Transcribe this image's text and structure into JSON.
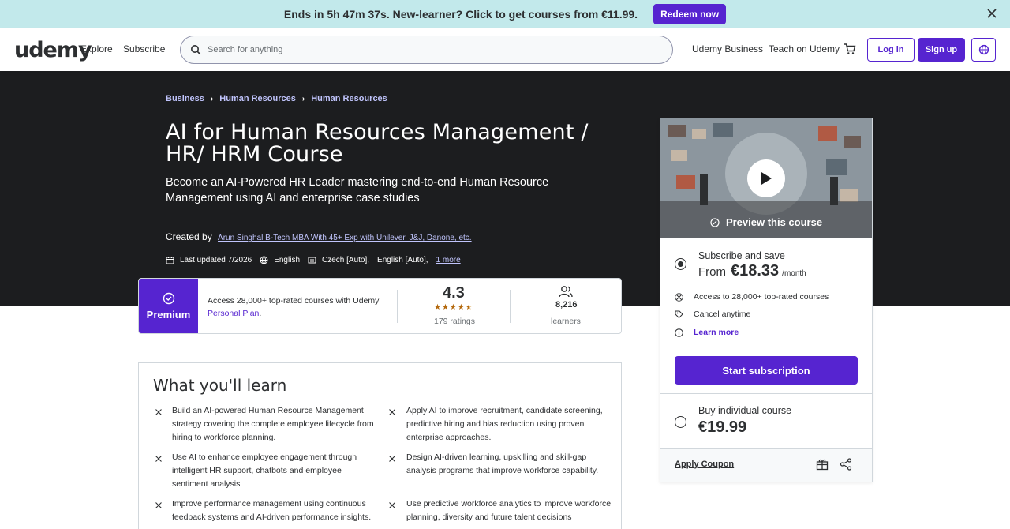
{
  "banner": {
    "text": "Ends in 5h 47m 37s. New-learner? Click to get courses from €11.99.",
    "button": "Redeem now",
    "bg_color": "#c2e9eb"
  },
  "header": {
    "logo": "udemy",
    "explore": "Explore",
    "subscribe": "Subscribe",
    "search_placeholder": "Search for anything",
    "business": "Udemy Business",
    "teach": "Teach on Udemy",
    "login": "Log in",
    "signup": "Sign up",
    "accent_color": "#5624d0"
  },
  "breadcrumb": [
    "Business",
    "Human Resources",
    "Human Resources"
  ],
  "course": {
    "title": "AI for Human Resources Management / HR/ HRM Course",
    "subtitle": "Become an AI-Powered HR Leader mastering end-to-end Human Resource Management using AI and enterprise case studies",
    "created_by_label": "Created by",
    "author": "Arun Singhal B-Tech MBA With 45+ Exp with Unilever, J&J, Danone, etc.",
    "last_updated": "Last updated 7/2026",
    "language": "English",
    "captions": [
      "Czech [Auto],",
      "English [Auto],"
    ],
    "more": "1 more"
  },
  "premium": {
    "label": "Premium",
    "text": "Access 28,000+ top-rated courses with Udemy",
    "link": "Personal Plan",
    "link_suffix": ".",
    "rating": "4.3",
    "stars": 4.5,
    "ratings_count": "179 ratings",
    "learners_count": "8,216",
    "learners_label": "learners"
  },
  "learn": {
    "title": "What you'll learn",
    "items": [
      "Build an AI-powered Human Resource Management strategy covering the complete employee lifecycle from hiring to workforce planning.",
      "Apply AI to improve recruitment, candidate screening, predictive hiring and bias reduction using proven enterprise approaches.",
      "Use AI to enhance employee engagement through intelligent HR support, chatbots and employee sentiment analysis",
      "Design AI-driven learning, upskilling and skill-gap analysis programs that improve workforce capability.",
      "Improve performance management using continuous feedback systems and AI-driven performance insights.",
      "Use predictive workforce analytics to improve workforce planning, diversity and future talent decisions"
    ]
  },
  "sidebar": {
    "preview": "Preview this course",
    "subscribe_label": "Subscribe and save",
    "from_label": "From",
    "sub_price": "€18.33",
    "per_month": "/month",
    "feature1": "Access to 28,000+ top-rated courses",
    "feature2": "Cancel anytime",
    "learn_more": "Learn more",
    "start_button": "Start subscription",
    "buy_label": "Buy individual course",
    "buy_price": "€19.99",
    "coupon": "Apply Coupon"
  }
}
